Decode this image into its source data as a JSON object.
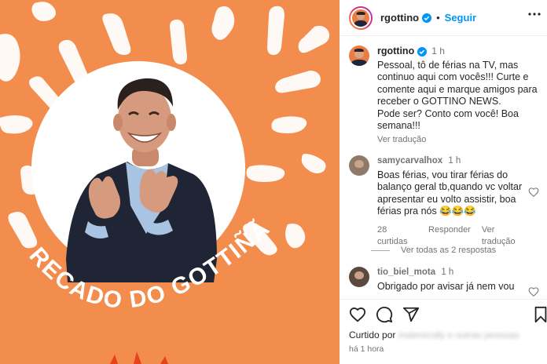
{
  "post": {
    "username": "rgottino",
    "follow_label": "Seguir",
    "header_separator": "•",
    "image_text": "RECADO DO GOTTIÑÃO",
    "caption": {
      "username": "rgottino",
      "time": "1 h",
      "text": "Pessoal, tô de férias na TV, mas continuo aqui com vocês!!! Curte e comente aqui e marque amigos para receber o GOTTINO NEWS.\nPode ser? Conto com você! Boa semana!!!",
      "translate_label": "Ver tradução"
    },
    "comments": [
      {
        "username": "samycarvalhox",
        "time": "1 h",
        "text": "Boas férias, vou tirar férias do balanço geral tb,quando vc voltar apresentar eu volto assistir, boa férias pra nós 😂😂😂",
        "likes": "28 curtidas",
        "reply_label": "Responder",
        "translate_label": "Ver tradução",
        "replies_label": "Ver todas as 2 respostas"
      },
      {
        "username": "tio_biel_mota",
        "time": "1 h",
        "text": "Obrigado por avisar já nem vou"
      }
    ],
    "liked_by_prefix": "Curtido por",
    "liked_by_blurred": "malenicolly e outras pessoas",
    "time_ago": "há 1 hora",
    "colors": {
      "image_bg": "#f38d4d",
      "accent_blue": "#0095f6",
      "muted": "#737373"
    }
  }
}
